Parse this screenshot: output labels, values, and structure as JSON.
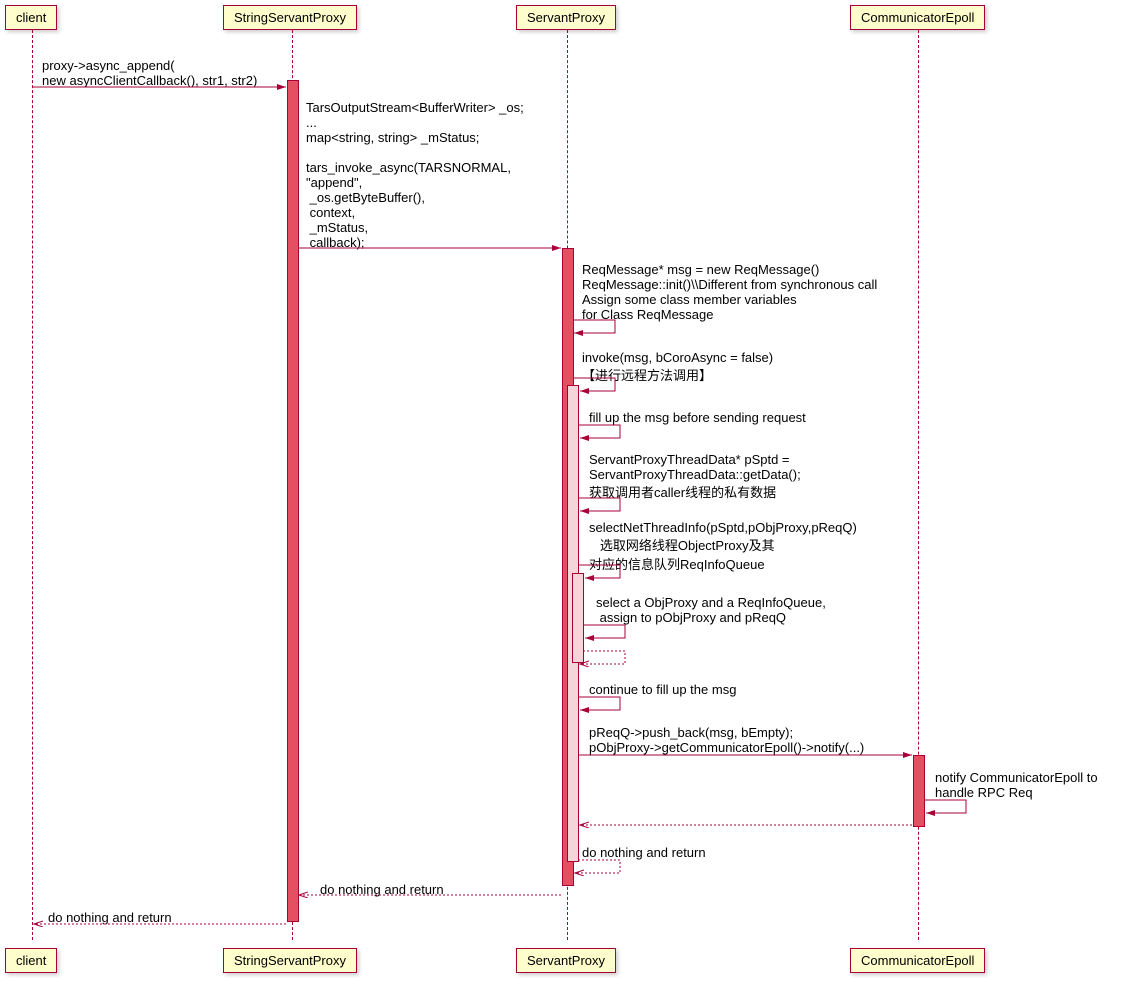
{
  "participants": {
    "client_top": "client",
    "ssp_top": "StringServantProxy",
    "sp_top": "ServantProxy",
    "ce_top": "CommunicatorEpoll",
    "client_bot": "client",
    "ssp_bot": "StringServantProxy",
    "sp_bot": "ServantProxy",
    "ce_bot": "CommunicatorEpoll"
  },
  "messages": {
    "m1": "proxy->async_append(\nnew asyncClientCallback(), str1, str2)",
    "m2": "TarsOutputStream<BufferWriter> _os;\n...\nmap<string, string> _mStatus;\n\ntars_invoke_async(TARSNORMAL,\n\"append\",\n _os.getByteBuffer(),\n context,\n _mStatus,\n callback);",
    "m3": "ReqMessage* msg = new ReqMessage()\nReqMessage::init()\\\\Different from synchronous call\nAssign some class member variables\nfor Class ReqMessage",
    "m4": "invoke(msg, bCoroAsync = false)\n【进行远程方法调用】",
    "m5": "fill up the msg before sending request",
    "m6": "ServantProxyThreadData* pSptd =\nServantProxyThreadData::getData();\n获取调用者caller线程的私有数据",
    "m7": "selectNetThreadInfo(pSptd,pObjProxy,pReqQ)\n   选取网络线程ObjectProxy及其\n对应的信息队列ReqInfoQueue",
    "m8": "select a ObjProxy and a ReqInfoQueue,\n assign to pObjProxy and pReqQ",
    "m9": "continue to fill up the msg",
    "m10": "pReqQ->push_back(msg, bEmpty);\npObjProxy->getCommunicatorEpoll()->notify(...)",
    "m11": "notify CommunicatorEpoll to\nhandle RPC Req",
    "m12": "do nothing and return",
    "m13": "do nothing and return",
    "m14": "do nothing and return"
  }
}
